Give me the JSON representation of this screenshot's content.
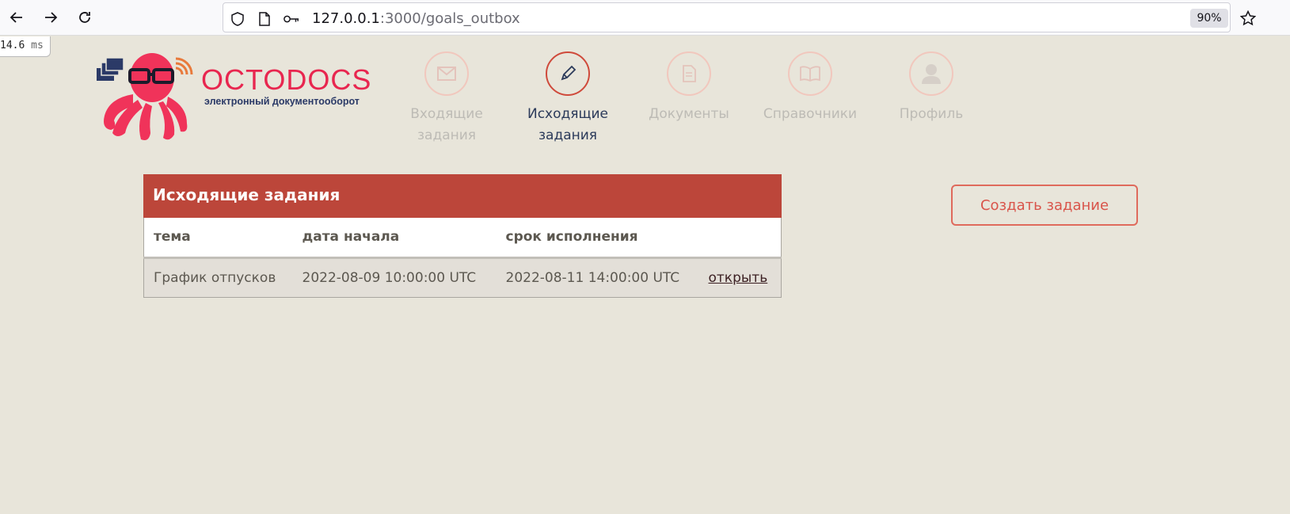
{
  "browser": {
    "url_host": "127.0.0.1",
    "url_path": ":3000/goals_outbox",
    "zoom": "90%"
  },
  "timing": {
    "value": "14.6",
    "unit": "ms"
  },
  "brand": {
    "name": "OCTODOCS",
    "tagline": "электронный документооборот"
  },
  "nav": {
    "items": [
      {
        "label_line1": "Входящие",
        "label_line2": "задания",
        "icon": "envelope-icon",
        "active": false
      },
      {
        "label_line1": "Исходящие",
        "label_line2": "задания",
        "icon": "pencil-icon",
        "active": true
      },
      {
        "label_line1": "Документы",
        "label_line2": "",
        "icon": "document-icon",
        "active": false
      },
      {
        "label_line1": "Справочники",
        "label_line2": "",
        "icon": "book-icon",
        "active": false
      },
      {
        "label_line1": "Профиль",
        "label_line2": "",
        "icon": "user-icon",
        "active": false
      }
    ]
  },
  "table": {
    "title": "Исходящие задания",
    "columns": [
      "тема",
      "дата начала",
      "срок исполнения"
    ],
    "rows": [
      {
        "topic": "График отпусков",
        "start": "2022-08-09 10:00:00 UTC",
        "due": "2022-08-11 14:00:00 UTC",
        "action": "открыть"
      }
    ]
  },
  "create_button": "Создать задание",
  "colors": {
    "accent": "#bc463a",
    "brand": "#e8264f",
    "background": "#e8e5da"
  }
}
